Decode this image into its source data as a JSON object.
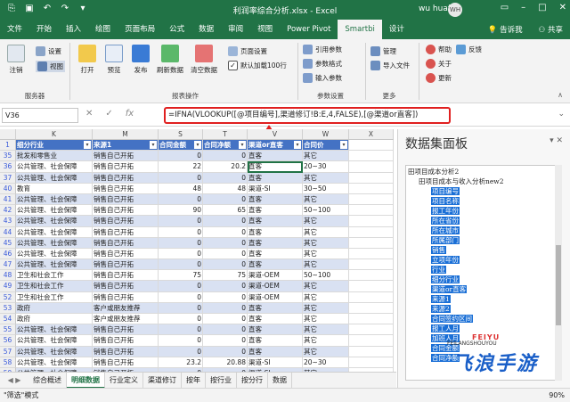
{
  "window": {
    "title": "利润率综合分析.xlsx  -  Excel",
    "user": "wu huafu",
    "avatar": "WH",
    "accent": "#217346"
  },
  "ribbon_tabs": [
    "文件",
    "开始",
    "插入",
    "绘图",
    "页面布局",
    "公式",
    "数据",
    "审阅",
    "视图",
    "Power Pivot",
    "Smartbi",
    "设计"
  ],
  "active_tab": "Smartbi",
  "ribbon_right": {
    "tell_me": "告诉我",
    "share": "共享"
  },
  "ribbon": {
    "server": {
      "settings": "设置",
      "logout": "注销",
      "view": "视图",
      "label": "服务器"
    },
    "report": {
      "open": "打开",
      "preview": "预览",
      "publish": "发布",
      "refresh": "刷新数据",
      "clear": "清空数据",
      "page_setup": "页面设置",
      "default_100": "默认加载100行",
      "label": "报表操作"
    },
    "params": {
      "ref_params": "引用参数",
      "param_format": "参数格式",
      "input_params": "输入参数",
      "label": "参数设置"
    },
    "more": {
      "manage": "管理",
      "import": "导入文件",
      "label": "更多"
    },
    "misc": {
      "help": "帮助",
      "feedback": "反馈",
      "about": "关于",
      "update": "更新"
    }
  },
  "formula_bar": {
    "name_box": "V36",
    "formula": "=IFNA(VLOOKUP([@项目编号],渠道修订!B:E,4,FALSE),[@渠道or直客])"
  },
  "grid": {
    "col_letters": [
      "K",
      "M",
      "S",
      "T",
      "V",
      "W",
      "X"
    ],
    "headers": [
      "细分行业",
      "来源1",
      "合同金额",
      "合同净额",
      "渠道or直客",
      "合同价",
      ""
    ],
    "row_numbers": [
      "1",
      "35",
      "36",
      "37",
      "40",
      "41",
      "42",
      "43",
      "44",
      "45",
      "46",
      "47",
      "48",
      "49",
      "52",
      "53",
      "54",
      "55",
      "56",
      "57",
      "58",
      "59",
      "60",
      "61",
      "62",
      "63"
    ],
    "rows": [
      [
        "批发和零售业",
        "销售自己开拓",
        "0",
        "0",
        "直客",
        "其它"
      ],
      [
        "公共管理、社会保障",
        "销售自己开拓",
        "22",
        "20.2",
        "直客",
        "20~30"
      ],
      [
        "公共管理、社会保障",
        "销售自己开拓",
        "0",
        "0",
        "直客",
        "其它"
      ],
      [
        "教育",
        "销售自己开拓",
        "48",
        "48",
        "渠道-SI",
        "30~50"
      ],
      [
        "公共管理、社会保障",
        "销售自己开拓",
        "0",
        "0",
        "直客",
        "其它"
      ],
      [
        "公共管理、社会保障",
        "销售自己开拓",
        "90",
        "65",
        "直客",
        "50~100"
      ],
      [
        "公共管理、社会保障",
        "销售自己开拓",
        "0",
        "0",
        "直客",
        "其它"
      ],
      [
        "公共管理、社会保障",
        "销售自己开拓",
        "0",
        "0",
        "直客",
        "其它"
      ],
      [
        "公共管理、社会保障",
        "销售自己开拓",
        "0",
        "0",
        "直客",
        "其它"
      ],
      [
        "公共管理、社会保障",
        "销售自己开拓",
        "0",
        "0",
        "直客",
        "其它"
      ],
      [
        "公共管理、社会保障",
        "销售自己开拓",
        "0",
        "0",
        "直客",
        "其它"
      ],
      [
        "卫生和社会工作",
        "销售自己开拓",
        "75",
        "75",
        "渠道-OEM",
        "50~100"
      ],
      [
        "卫生和社会工作",
        "销售自己开拓",
        "0",
        "0",
        "渠道-OEM",
        "其它"
      ],
      [
        "卫生和社会工作",
        "销售自己开拓",
        "0",
        "0",
        "渠道-OEM",
        "其它"
      ],
      [
        "政府",
        "客户或朋友推荐",
        "0",
        "0",
        "直客",
        "其它"
      ],
      [
        "政府",
        "客户或朋友推荐",
        "0",
        "0",
        "直客",
        "其它"
      ],
      [
        "公共管理、社会保障",
        "销售自己开拓",
        "0",
        "0",
        "直客",
        "其它"
      ],
      [
        "公共管理、社会保障",
        "销售自己开拓",
        "0",
        "0",
        "直客",
        "其它"
      ],
      [
        "公共管理、社会保障",
        "销售自己开拓",
        "0",
        "0",
        "直客",
        "其它"
      ],
      [
        "公共管理、社会保障",
        "销售自己开拓",
        "23.2",
        "20.88",
        "渠道-SI",
        "20~30"
      ],
      [
        "公共管理、社会保障",
        "销售自己开拓",
        "0",
        "0",
        "渠道-SI",
        "其它"
      ],
      [
        "公共管理、社会保障",
        "销售自己开拓",
        "18",
        "15",
        "渠道-SI",
        "20~30"
      ],
      [
        "公共管理、社会保障",
        "销售自己开拓",
        "0",
        "0",
        "渠道-SI",
        "其它"
      ],
      [
        "公共管理、社会保障",
        "销售自己开拓",
        "0",
        "0",
        "渠道-SI",
        "其它"
      ]
    ]
  },
  "sheet_tabs": [
    "综合概述",
    "明细数据",
    "行业定义",
    "渠道修订",
    "按年",
    "按行业",
    "按分行",
    "数据"
  ],
  "active_sheet": "明细数据",
  "status": {
    "mode": "\"筛选\"模式",
    "zoom": "90%"
  },
  "pane": {
    "title": "数据集面板",
    "tree": [
      {
        "text": "田项目成本分析2",
        "level": 0,
        "hl": false
      },
      {
        "text": "田项目成本与收入分析new2",
        "level": 1,
        "hl": false
      },
      {
        "text": "项目编号",
        "level": 2,
        "hl": true
      },
      {
        "text": "项目名称",
        "level": 2,
        "hl": true
      },
      {
        "text": "报工年份",
        "level": 2,
        "hl": true
      },
      {
        "text": "所在省份",
        "level": 2,
        "hl": true
      },
      {
        "text": "所在城市",
        "level": 2,
        "hl": true
      },
      {
        "text": "所属部门",
        "level": 2,
        "hl": true
      },
      {
        "text": "销售",
        "level": 2,
        "hl": true
      },
      {
        "text": "立项年份",
        "level": 2,
        "hl": true
      },
      {
        "text": "行业",
        "level": 2,
        "hl": true
      },
      {
        "text": "细分行业",
        "level": 2,
        "hl": true
      },
      {
        "text": "渠道or直客",
        "level": 2,
        "hl": true
      },
      {
        "text": "来源1",
        "level": 2,
        "hl": true
      },
      {
        "text": "来源2",
        "level": 2,
        "hl": true
      },
      {
        "text": "合同签约区间",
        "level": 2,
        "hl": true
      },
      {
        "text": "报工人月",
        "level": 2,
        "hl": true
      },
      {
        "text": "加班人月",
        "level": 2,
        "hl": true
      },
      {
        "text": "合同金额",
        "level": 2,
        "hl": true
      },
      {
        "text": "合同净额",
        "level": 2,
        "hl": true
      }
    ]
  },
  "watermark": {
    "line1": "FEIYU",
    "line2": "FEILANGSHOUYOU",
    "line3": "飞浪手游"
  }
}
